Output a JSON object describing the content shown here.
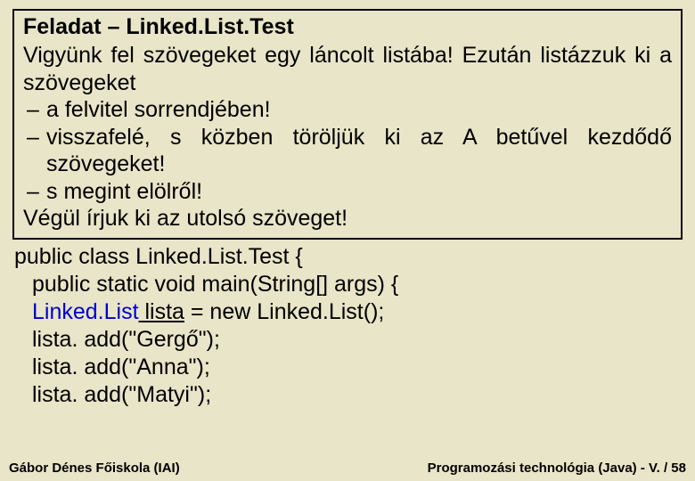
{
  "task": {
    "title": "Feladat – Linked.List.Test",
    "intro": "Vigyünk fel szövegeket egy láncolt listába! Ezután listázzuk ki a szövegeket",
    "bullets": [
      "a felvitel sorrendjében!",
      "visszafelé, s közben töröljük ki az A betűvel kezdődő szövegeket!",
      "s megint elölről!"
    ],
    "outro": "Végül írjuk ki az utolsó szöveget!"
  },
  "code": {
    "l1": "public class Linked.List.Test {",
    "l2": "public static void main(String[] args) {",
    "l3a": "Linked.List",
    "l3b": " lista",
    "l3c": " = new Linked.List();",
    "l4": "lista. add(\"Gergő\");",
    "l5": "lista. add(\"Anna\");",
    "l6": "lista. add(\"Matyi\");"
  },
  "footer": {
    "left": "Gábor Dénes Főiskola (IAI)",
    "right": "Programozási technológia (Java)  -  V. / 58"
  }
}
